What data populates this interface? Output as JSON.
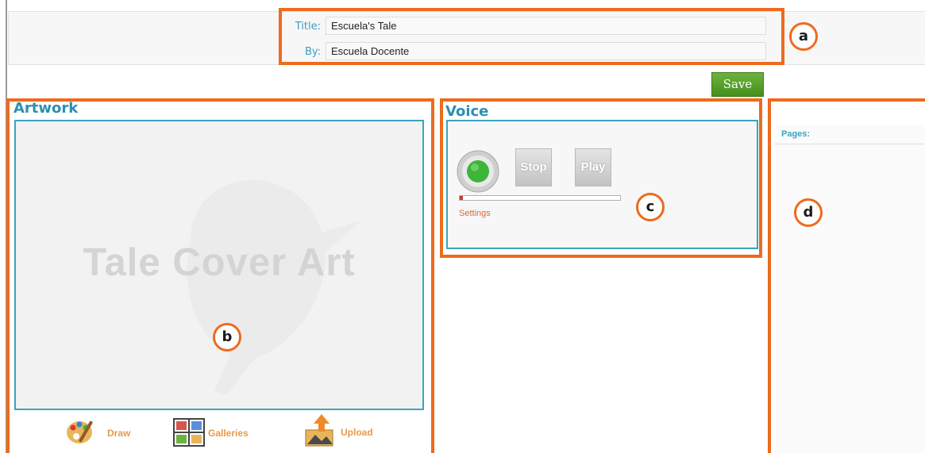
{
  "form": {
    "title_label": "Title:",
    "title_value": "Escuela's Tale",
    "by_label": "By:",
    "by_value": "Escuela Docente"
  },
  "toolbar": {
    "save_label": "Save"
  },
  "artwork": {
    "heading": "Artwork",
    "cover_placeholder": "Tale Cover Art",
    "tools": [
      {
        "label": "Draw",
        "icon": "palette-icon"
      },
      {
        "label": "Galleries",
        "icon": "gallery-grid-icon"
      },
      {
        "label": "Upload",
        "icon": "upload-arrow-icon"
      }
    ]
  },
  "voice": {
    "heading": "Voice",
    "stop_label": "Stop",
    "play_label": "Play",
    "settings_label": "Settings",
    "record_level": 0.02
  },
  "pages": {
    "heading": "Pages:"
  },
  "callouts": {
    "a": "a",
    "b": "b",
    "c": "c",
    "d": "d"
  },
  "colors": {
    "highlight": "#ef6a1e",
    "accent": "#3aa5be",
    "save_button": "#5aa12c",
    "record_green": "#3cb539"
  }
}
